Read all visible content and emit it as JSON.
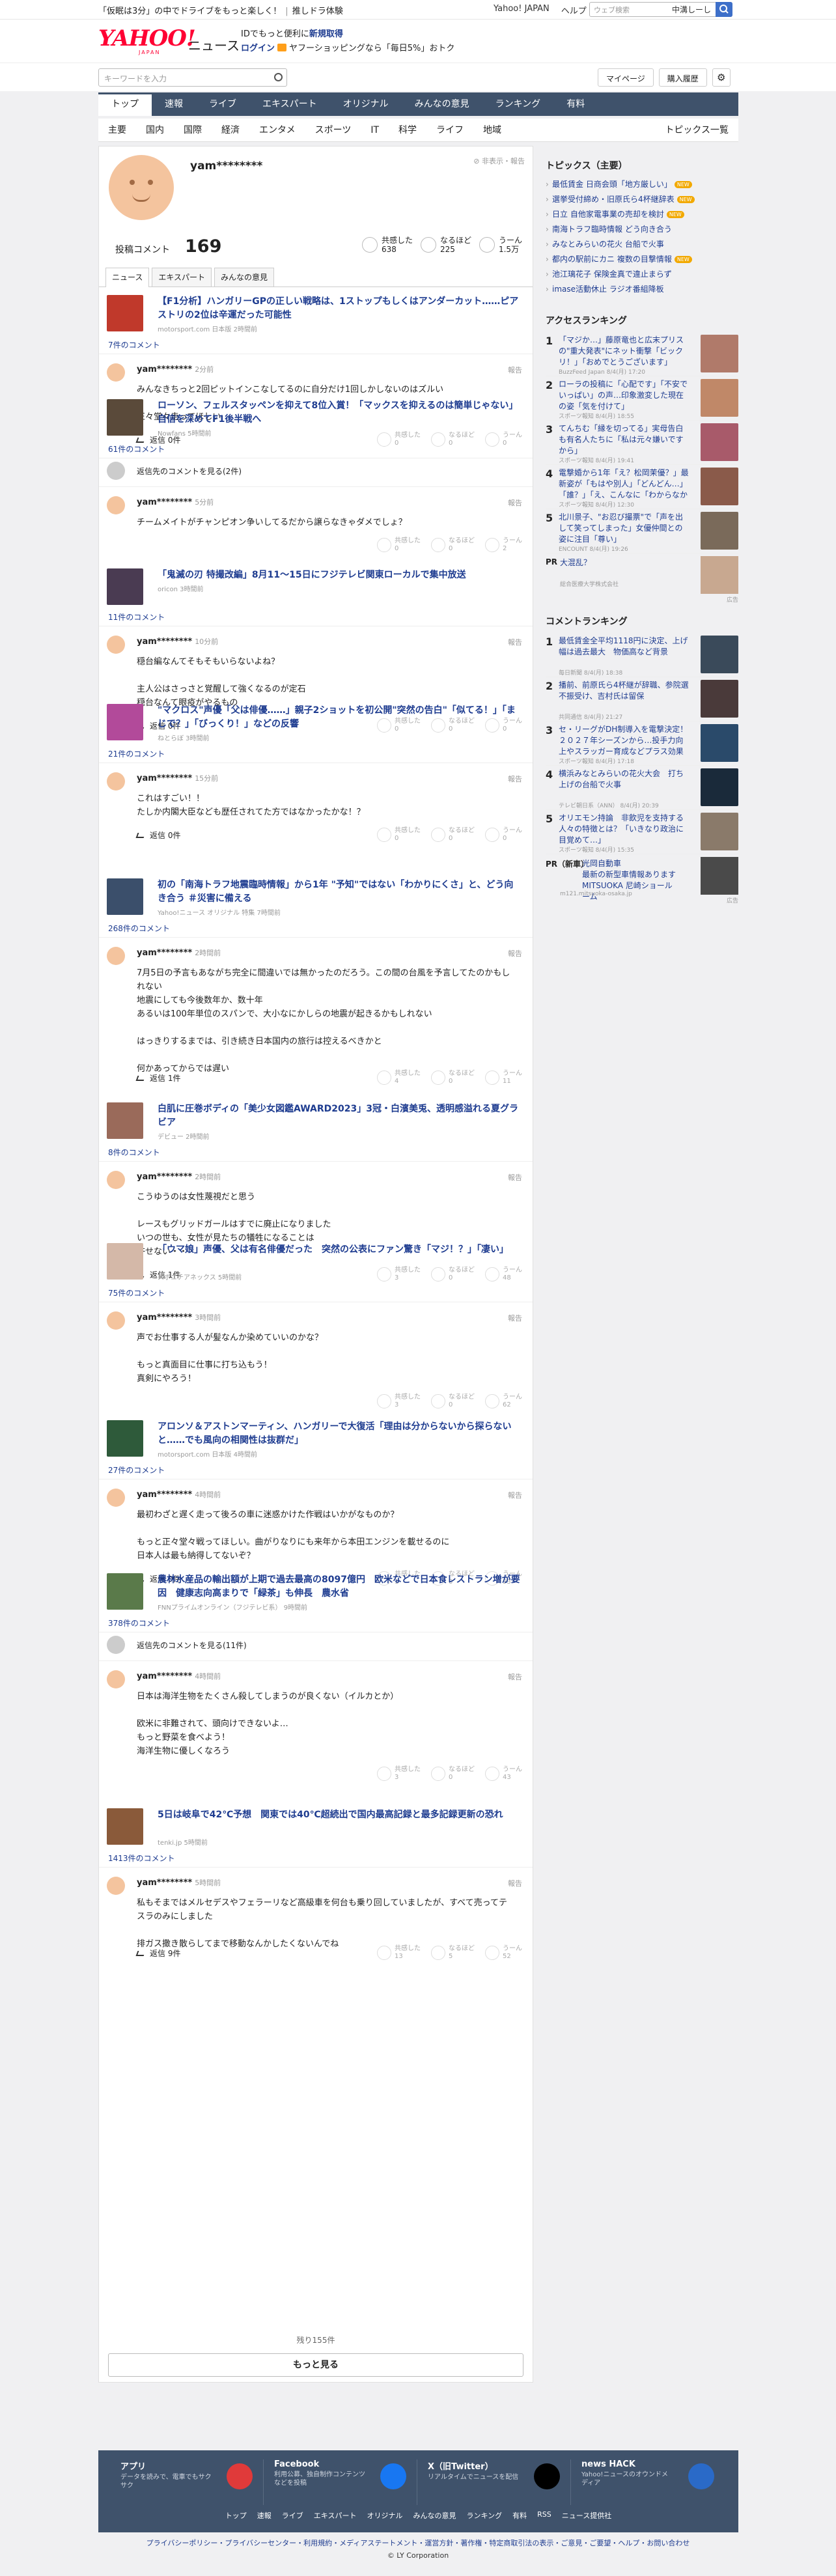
{
  "topbar": {
    "promo1": "「仮眠は3分」",
    "promo2": "の中でドライブをもっと楽しく！",
    "promo3": "推しドラ体験",
    "yj": "Yahoo! JAPAN",
    "help": "ヘルプ",
    "search_ph": "ウェブ検索",
    "search_sel": "中溝しーし"
  },
  "header": {
    "logo": "YAHOO!",
    "logo_sub": "JAPAN",
    "service": "ニュース",
    "line1_a": "IDでもっと便利に",
    "line1_b": "新規取得",
    "line2_a": "ログイン",
    "line2_b": "ヤフーショッピングなら「毎日5%」おトク"
  },
  "search": {
    "placeholder": "キーワードを入力",
    "mypage": "マイページ",
    "history": "購入履歴"
  },
  "mainnav": [
    "トップ",
    "速報",
    "ライブ",
    "エキスパート",
    "オリジナル",
    "みんなの意見",
    "ランキング",
    "有料"
  ],
  "subnav": [
    "主要",
    "国内",
    "国際",
    "経済",
    "エンタメ",
    "スポーツ",
    "IT",
    "科学",
    "ライフ",
    "地域"
  ],
  "subnav_all": "トピックス一覧",
  "profile": {
    "name": "yam********",
    "report": "非表示・報告",
    "comment_label": "投稿コメント",
    "comment_count": "169",
    "reactions": [
      {
        "label": "共感した",
        "value": "638"
      },
      {
        "label": "なるほど",
        "value": "225"
      },
      {
        "label": "うーん",
        "value": "1.5万"
      }
    ]
  },
  "tabs": [
    "ニュース",
    "エキスパート",
    "みんなの意見"
  ],
  "items": [
    {
      "title": "【F1分析】ハンガリーGPの正しい戦略は、1ストップもしくはアンダーカット……ピアストリの2位は辛運だった可能性",
      "meta": "motorsport.com 日本版 2時間前",
      "count": "7件のコメント",
      "thumb": "#c0392b",
      "comments": [
        {
          "user": "yam********",
          "time": "2分前",
          "body": "みんなきちっと2回ピットインこなしてるのに自分だけ1回しかしないのはズルい\n\n正々堂々走ってほしい",
          "reply": "返信 0件",
          "rx": [
            "0",
            "0",
            "0"
          ]
        }
      ]
    },
    {
      "title": "ローソン、フェルスタッペンを抑えて8位入賞！「マックスを抑えるのは簡単じゃない」自信を深めてF1後半戦へ",
      "meta": "Nowfans 5時間前",
      "count": "61件のコメント",
      "thumb": "#5a4a3a",
      "pending": "返信先のコメントを見る(2件)",
      "comments": [
        {
          "user": "yam********",
          "time": "5分前",
          "body": "チームメイトがチャンピオン争いしてるだから譲らなきゃダメでしょ？",
          "reply": "",
          "rx": [
            "0",
            "0",
            "2"
          ]
        }
      ]
    },
    {
      "title": "「鬼滅の刃 特撮改編」8月11〜15日にフジテレビ関東ローカルで集中放送",
      "meta": "oricon 3時間前",
      "count": "11件のコメント",
      "thumb": "#4a3b52",
      "comments": [
        {
          "user": "yam********",
          "time": "10分前",
          "body": "穏台編なんてそもそもいらないよね？\n\n主人公はさっさと覚醒して強くなるのが定石\n穏台なんて眼疫がやるもの",
          "reply": "返信 0件",
          "rx": [
            "0",
            "0",
            "0"
          ]
        }
      ]
    },
    {
      "title": "\"マクロス\"声優「父は俳優……」親子2ショットを初公開\"突然の告白\"「似てる！」「まじで？」「びっくり！」などの反響",
      "meta": "ねとらぼ 3時間前",
      "count": "21件のコメント",
      "thumb": "#b24a9a",
      "comments": [
        {
          "user": "yam********",
          "time": "15分前",
          "body": "これはすごい！！\nたしか内閣大臣なども歴任されてた方ではなかったかな！？",
          "reply": "返信 0件",
          "rx": [
            "0",
            "0",
            "0"
          ]
        }
      ]
    },
    {
      "title": "初の「南海トラフ地震臨時情報」から1年 \"予知\"ではない「わかりにくさ」と、どう向き合う ＃災害に備える",
      "meta": "Yahoo!ニュース オリジナル 特集 7時間前",
      "count": "268件のコメント",
      "thumb": "#3b4f6b",
      "comments": [
        {
          "user": "yam********",
          "time": "2時間前",
          "body": "7月5日の予言もあながち完全に間違いでは無かったのだろう。この間の台風を予言してたのかもしれない\n地震にしても今後数年か、数十年\nあるいは100年単位のスパンで、大小なにかしらの地震が起きるかもしれない\n\nはっきりするまでは、引き続き日本国内の旅行は控えるべきかと\n\n何かあってからでは遅い",
          "reply": "返信 1件",
          "rx": [
            "4",
            "0",
            "11"
          ]
        }
      ]
    },
    {
      "title": "白肌に圧巻ボディの「美少女図鑑AWARD2023」3冠・白濱美兎、透明感溢れる夏グラビア",
      "meta": "デビュー 2時間前",
      "count": "8件のコメント",
      "thumb": "#9a6a5a",
      "comments": [
        {
          "user": "yam********",
          "time": "2時間前",
          "body": "こうゆうのは女性蔑視だと思う\n\nレースもグリッドガールはすでに廃止になりました\nいつの世も、女性が見たちの犠牲になることは\n許せない・・・",
          "reply": "返信 1件",
          "rx": [
            "3",
            "0",
            "48"
          ]
        }
      ]
    },
    {
      "title": "「ウマ娘」声優、父は有名俳優だった　突然の公表にファン驚き「マジ！？」「凄い」",
      "meta": "スポニチアネックス 5時間前",
      "count": "75件のコメント",
      "thumb": "#d4b8a8",
      "comments": [
        {
          "user": "yam********",
          "time": "3時間前",
          "body": "声でお仕事する人が髪なんか染めていいのかな？\n\nもっと真面目に仕事に打ち込もう！\n真剣にやろう！",
          "reply": "",
          "rx": [
            "3",
            "0",
            "62"
          ]
        }
      ]
    },
    {
      "title": "アロンソ＆アストンマーティン、ハンガリーで大復活「理由は分からないから探らないと……でも風向の相関性は抜群だ」",
      "meta": "motorsport.com 日本版 4時間前",
      "count": "27件のコメント",
      "thumb": "#2e5a3a",
      "comments": [
        {
          "user": "yam********",
          "time": "4時間前",
          "body": "最初わざと遅く走って後ろの車に迷惑かけた作戦はいかがなものか？\n\nもっと正々堂々戦ってほしい。曲がりなりにも来年から本田エンジンを載せるのに\n日本人は最も納得してないぞ？",
          "reply": "返信 0件",
          "rx": [
            "1",
            "0",
            "93"
          ]
        }
      ]
    },
    {
      "title": "農林水産品の輸出額が上期で過去最高の8097億円　欧米などで日本食レストラン増が要因　健康志向高まりで「緑茶」も伸長　農水省",
      "meta": "FNNプライムオンライン（フジテレビ系） 9時間前",
      "count": "378件のコメント",
      "thumb": "#5a7a4a",
      "pending": "返信先のコメントを見る(11件)",
      "comments": [
        {
          "user": "yam********",
          "time": "4時間前",
          "body": "日本は海洋生物をたくさん殺してしまうのが良くない（イルカとか）\n\n欧米に非難されて、頭向けできないよ…\nもっと野菜を食べよう！\n海洋生物に優しくなろう",
          "reply": "",
          "rx": [
            "3",
            "0",
            "43"
          ]
        }
      ]
    },
    {
      "title": "5日は岐阜で42℃予想　関東では40℃超続出で国内最高記録と最多記録更新の恐れ",
      "meta": "tenki.jp 5時間前",
      "count": "1413件のコメント",
      "thumb": "#8a5a3a",
      "comments": [
        {
          "user": "yam********",
          "time": "5時間前",
          "body": "私もそまではメルセデスやフェラーリなど高級車を何台も乗り回していましたが、すべて売ってテスラのみにしました\n\n排ガス撒き散らしてまで移動なんかしたくないんでね",
          "reply": "返信 9件",
          "rx": [
            "13",
            "5",
            "52"
          ]
        }
      ]
    }
  ],
  "more": {
    "remain": "残り155件",
    "button": "もっと見る"
  },
  "topics": {
    "heading": "トピックス（主要）",
    "items": [
      {
        "t": "最低賃金 日商会頭「地方厳しい」",
        "b": "NEW"
      },
      {
        "t": "選挙受付締め・旧原氏ら4杯継辞表",
        "b": "NEW"
      },
      {
        "t": "日立 自他家電事業の売却を検討",
        "b": "NEW"
      },
      {
        "t": "南海トラフ臨時情報 どう向き合う",
        "b": ""
      },
      {
        "t": "みなとみらいの花火 台船で火事",
        "b": ""
      },
      {
        "t": "都内の駅前にカニ 複数の目撃情報",
        "b": "NEW"
      },
      {
        "t": "池江璃花子 保険金真で違止まらず",
        "b": ""
      },
      {
        "t": "imase活動休止 ラジオ番組降板",
        "b": ""
      }
    ]
  },
  "access": {
    "heading": "アクセスランキング",
    "items": [
      {
        "n": "1",
        "t": "「マジか…」藤原竜也と広末プリスの\"重大発表\"にネット衝撃「ビックリ！」「おめでとうございます」",
        "m": "BuzzFeed Japan 8/4(月) 17:20",
        "c": "#b07a6a"
      },
      {
        "n": "2",
        "t": "ローラの投稿に「心配です」「不安でいっぱい」の声…印象激変した現在の姿「気を付けて」",
        "m": "スポーツ報知 8/4(月) 18:55",
        "c": "#c08868"
      },
      {
        "n": "3",
        "t": "てんちむ「縁を切ってる」実母告白も有名人たちに「私は元々嫌いですから」",
        "m": "スポーツ報知 8/4(月) 19:41",
        "c": "#a85a6a"
      },
      {
        "n": "4",
        "t": "電撃婚から1年「え？松岡茉優？」最新姿が「もはや別人」「どんどん…」「誰？」「え、こんなに「わからなかった」",
        "m": "スポーツ報知 8/4(月) 12:30",
        "c": "#8a5a4a"
      },
      {
        "n": "5",
        "t": "北川景子、\"お忍び撮票\"で「声を出して笑ってしまった」女優仲間との姿に注目「尊い」",
        "m": "ENCOUNT 8/4(月) 19:26",
        "c": "#7a6a5a"
      }
    ],
    "pr": {
      "label": "PR",
      "t": "大混乱？",
      "m": "総合医療大学株式会社",
      "c": "#c8a890",
      "ad": "広告"
    }
  },
  "commentrank": {
    "heading": "コメントランキング",
    "items": [
      {
        "n": "1",
        "t": "最低賃金全平均1118円に決定、上げ幅は過去最大　物価高など背景",
        "m": "毎日新聞 8/4(月) 18:38",
        "c": "#3a4a5a"
      },
      {
        "n": "2",
        "t": "播前、前原氏ら4杯継が辞職、参院選不振受け、吉村氏は留保",
        "m": "共同通信 8/4(月) 21:27",
        "c": "#4a3a3a"
      },
      {
        "n": "3",
        "t": "セ・リーグがDH制導入を電撃決定！　２０２７年シーズンから…投手力向上やスラッガー育成などプラス効果多数",
        "m": "スポーツ報知 8/4(月) 17:18",
        "c": "#2a4a6a"
      },
      {
        "n": "4",
        "t": "横浜みなとみらいの花火大会　打ち上げの台船で火事",
        "m": "テレビ朝日系（ANN） 8/4(月) 20:39",
        "c": "#1a2a3a"
      },
      {
        "n": "5",
        "t": "オリエモン持論　非飲児を支持する人々の特徴とは？「いきなり政治に目覚めて…」",
        "m": "スポーツ報知 8/4(月) 15:35",
        "c": "#8a7a6a"
      }
    ],
    "pr": {
      "label": "PR（新車）",
      "t": "光岡自動車\n最新の新型車情報ありますMITSUOKA 尼崎ショールーム",
      "m": "m121.mitsuoka-osaka.jp",
      "c": "#4a4a4a",
      "ad": "広告"
    }
  },
  "footer": {
    "apps": [
      {
        "h": "アプリ",
        "d": "データを読みで、電車でもサクサク",
        "c": "#e03a3a"
      },
      {
        "h": "Facebook",
        "d": "利用公募、独自制作コンテンツなどを投稿",
        "c": "#1877f2"
      },
      {
        "h": "X（旧Twitter）",
        "d": "リアルタイムでニュースを配信",
        "c": "#000000"
      },
      {
        "h": "news HACK",
        "d": "Yahoo!ニュースのオウンドメディア",
        "c": "#2a6ac8"
      }
    ],
    "links": [
      "トップ",
      "速報",
      "ライブ",
      "エキスパート",
      "オリジナル",
      "みんなの意見",
      "ランキング",
      "有料",
      "RSS",
      "ニュース提供社"
    ],
    "legal": "プライバシーポリシー・プライバシーセンター・利用規約・メディアステートメント・運営方針・著作権・特定商取引法の表示・ご意見・ご要望・ヘルプ・お問い合わせ",
    "copyright": "© LY Corporation"
  }
}
